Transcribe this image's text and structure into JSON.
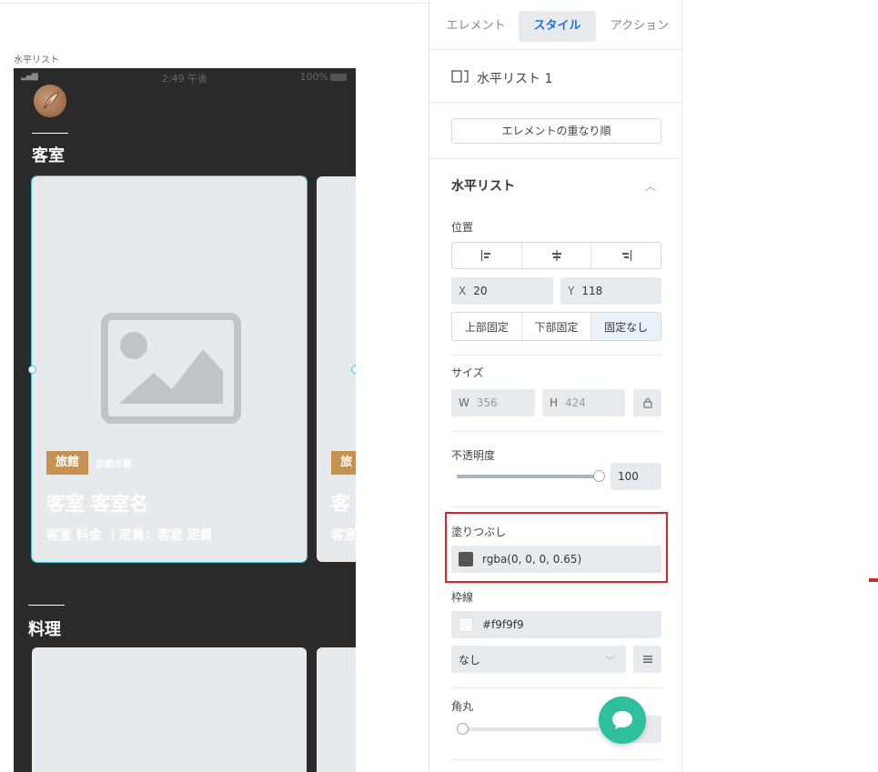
{
  "canvas": {
    "label": "水平リスト",
    "status": {
      "signal": "▂▄▆",
      "time": "2:49 午後",
      "battery": "100%"
    },
    "sections": [
      {
        "title": "客室"
      },
      {
        "title": "料理"
      }
    ],
    "cards": [
      {
        "badge": "旅館",
        "badge_sub": "京都の宿",
        "title": "客室 客室名",
        "subtitle": "客室 料金 ｜定員：客室 定員"
      },
      {
        "badge": "旅",
        "title": "客",
        "subtitle": "客室"
      }
    ]
  },
  "panel": {
    "tabs": [
      {
        "label": "エレメント"
      },
      {
        "label": "スタイル",
        "active": true
      },
      {
        "label": "アクション"
      }
    ],
    "element_name": "水平リスト 1",
    "layer_order_button": "エレメントの重なり順",
    "section_title": "水平リスト",
    "position": {
      "label": "位置",
      "x_key": "X",
      "x_value": "20",
      "y_key": "Y",
      "y_value": "118",
      "pin": [
        "上部固定",
        "下部固定",
        "固定なし"
      ]
    },
    "size": {
      "label": "サイズ",
      "w_key": "W",
      "w_value": "356",
      "h_key": "H",
      "h_value": "424"
    },
    "opacity": {
      "label": "不透明度",
      "value": "100",
      "level": 1.0
    },
    "fill": {
      "label": "塗りつぶし",
      "value": "rgba(0, 0, 0, 0.65)"
    },
    "border": {
      "label": "枠線",
      "color": "#f9f9f9",
      "style": "なし"
    },
    "radius": {
      "label": "角丸",
      "level": 0.0
    }
  },
  "colors": {
    "accent": "#1a73e8",
    "badge": "#c79152",
    "fab": "#2ebf9e",
    "highlight": "#d9262a",
    "canvas_bg": "#2a2a2a"
  }
}
